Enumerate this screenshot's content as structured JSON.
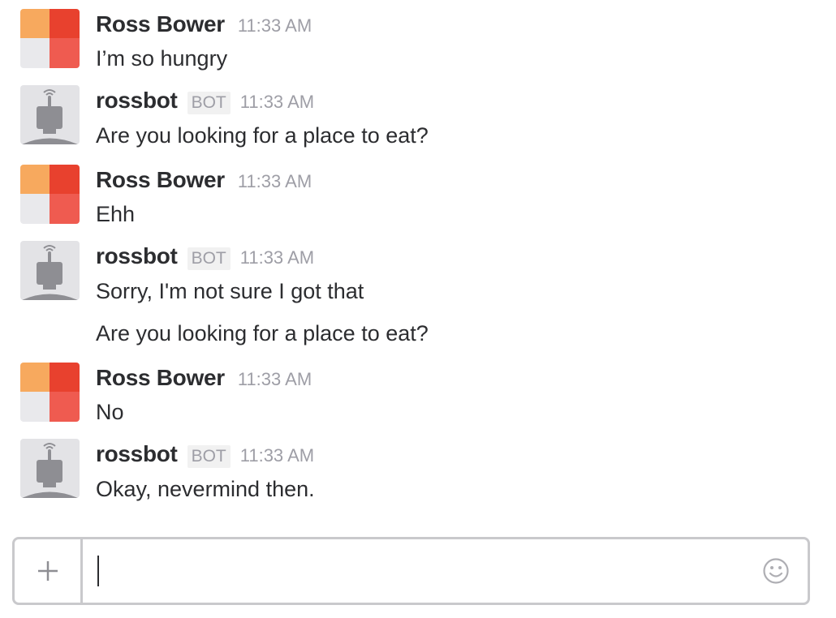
{
  "messages": [
    {
      "sender": "Ross Bower",
      "bot_badge": "",
      "time": "11:33 AM",
      "lines": [
        "I’m so hungry"
      ]
    },
    {
      "sender": "rossbot",
      "bot_badge": "BOT",
      "time": "11:33 AM",
      "lines": [
        "Are you looking for a place to eat?"
      ]
    },
    {
      "sender": "Ross Bower",
      "bot_badge": "",
      "time": "11:33 AM",
      "lines": [
        "Ehh"
      ]
    },
    {
      "sender": "rossbot",
      "bot_badge": "BOT",
      "time": "11:33 AM",
      "lines": [
        "Sorry, I'm not sure I got that",
        "Are you looking for a place to eat?"
      ]
    },
    {
      "sender": "Ross Bower",
      "bot_badge": "",
      "time": "11:33 AM",
      "lines": [
        "No"
      ]
    },
    {
      "sender": "rossbot",
      "bot_badge": "BOT",
      "time": "11:33 AM",
      "lines": [
        "Okay, nevermind then."
      ]
    }
  ],
  "composer": {
    "value": "",
    "add_icon": "plus-icon",
    "emoji_icon": "smiley-icon"
  },
  "colors": {
    "user_avatar": [
      "#f7a95e",
      "#e8412e",
      "#e9e9ec",
      "#ef5b50"
    ],
    "bot_avatar_bg": "#e3e3e6",
    "bot_avatar_fg": "#8e8e93",
    "border": "#c9c9cc",
    "muted_text": "#9e9ea6"
  }
}
